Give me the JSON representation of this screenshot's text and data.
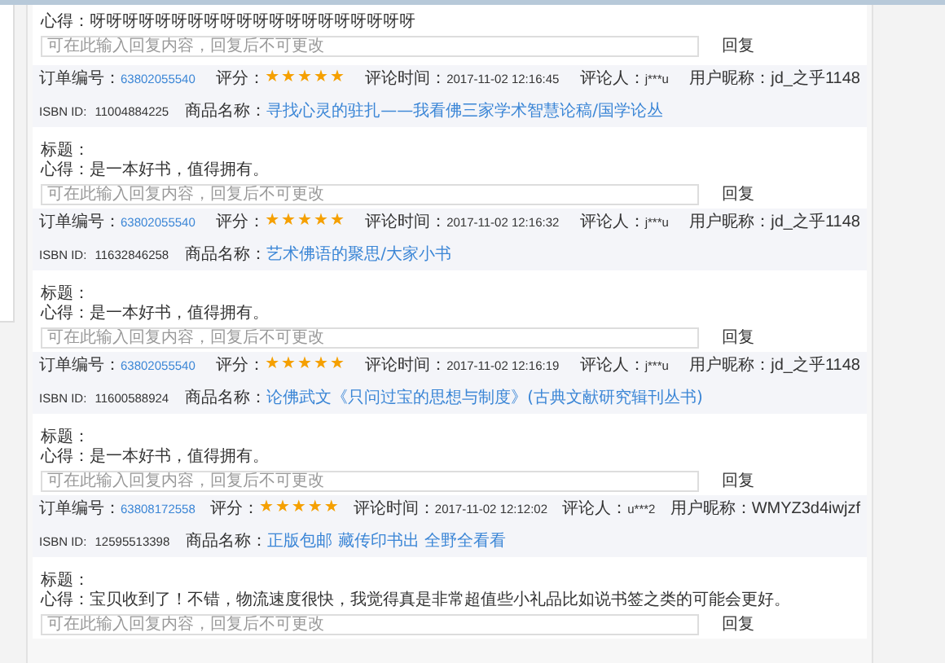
{
  "top_review": {
    "comment_label": "心得：",
    "comment": "呀呀呀呀呀呀呀呀呀呀呀呀呀呀呀呀呀呀呀呀",
    "reply_placeholder": "可在此输入回复内容，回复后不可更改",
    "reply_button": "回复"
  },
  "reviews": [
    {
      "order_label": "订单编号：",
      "order_no": "63802055540",
      "rating_label": "评分：",
      "stars": 5,
      "time_label": "评论时间：",
      "time": "2017-11-02 12:16:45",
      "reviewer_label": "评论人：",
      "reviewer": "j***u",
      "nickname_label": "用户昵称：",
      "nickname": "jd_之乎1148",
      "isbn_label": "ISBN ID:",
      "isbn": "11004884225",
      "product_label": "商品名称：",
      "product": "寻找心灵的驻扎——我看佛三家学术智慧论稿/国学论丛",
      "title_label": "标题：",
      "comment_label": "心得：",
      "comment": "是一本好书，值得拥有。",
      "reply_placeholder": "可在此输入回复内容，回复后不可更改",
      "reply_button": "回复"
    },
    {
      "order_label": "订单编号：",
      "order_no": "63802055540",
      "rating_label": "评分：",
      "stars": 5,
      "time_label": "评论时间：",
      "time": "2017-11-02 12:16:32",
      "reviewer_label": "评论人：",
      "reviewer": "j***u",
      "nickname_label": "用户昵称：",
      "nickname": "jd_之乎1148",
      "isbn_label": "ISBN ID:",
      "isbn": "11632846258",
      "product_label": "商品名称：",
      "product": "艺术佛语的聚思/大家小书",
      "title_label": "标题：",
      "comment_label": "心得：",
      "comment": "是一本好书，值得拥有。",
      "reply_placeholder": "可在此输入回复内容，回复后不可更改",
      "reply_button": "回复"
    },
    {
      "order_label": "订单编号：",
      "order_no": "63802055540",
      "rating_label": "评分：",
      "stars": 5,
      "time_label": "评论时间：",
      "time": "2017-11-02 12:16:19",
      "reviewer_label": "评论人：",
      "reviewer": "j***u",
      "nickname_label": "用户昵称：",
      "nickname": "jd_之乎1148",
      "isbn_label": "ISBN ID:",
      "isbn": "11600588924",
      "product_label": "商品名称：",
      "product": "论佛武文《只问过宝的思想与制度》(古典文献研究辑刊丛书)",
      "title_label": "标题：",
      "comment_label": "心得：",
      "comment": "是一本好书，值得拥有。",
      "reply_placeholder": "可在此输入回复内容，回复后不可更改",
      "reply_button": "回复"
    },
    {
      "order_label": "订单编号：",
      "order_no": "63808172558",
      "rating_label": "评分：",
      "stars": 5,
      "time_label": "评论时间：",
      "time": "2017-11-02 12:12:02",
      "reviewer_label": "评论人：",
      "reviewer": "u***2",
      "nickname_label": "用户昵称：",
      "nickname": "WMYZ3d4iwjzf",
      "isbn_label": "ISBN ID:",
      "isbn": "12595513398",
      "product_label": "商品名称：",
      "product": "正版包邮 藏传印书出 全野全看看",
      "title_label": "标题：",
      "comment_label": "心得：",
      "comment": "宝贝收到了！不错，物流速度很快，我觉得真是非常超值些小礼品比如说书签之类的可能会更好。",
      "reply_placeholder": "可在此输入回复内容，回复后不可更改",
      "reply_button": "回复"
    }
  ]
}
